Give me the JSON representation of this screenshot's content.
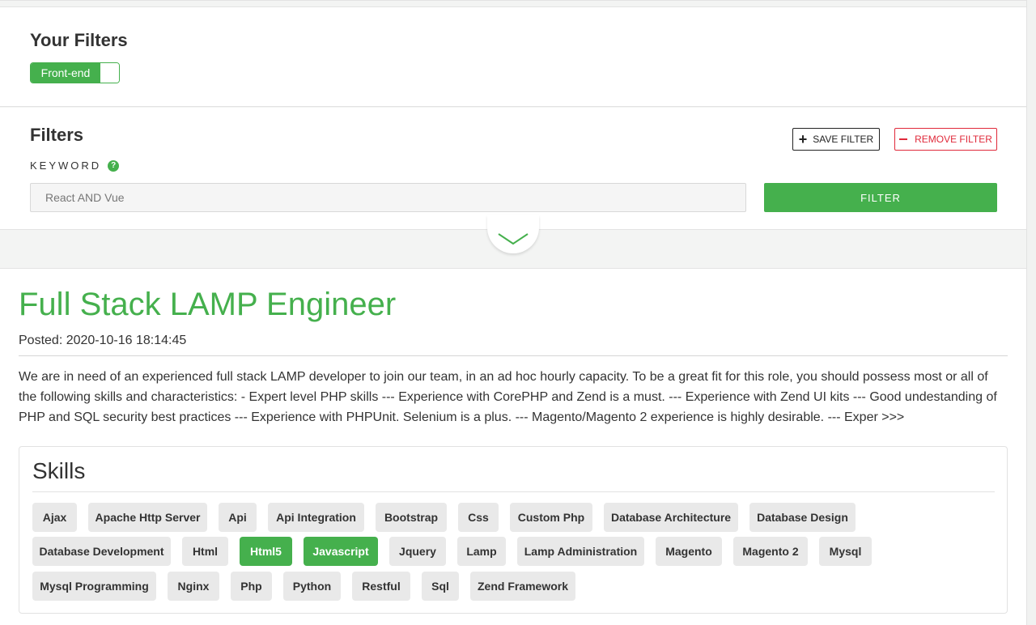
{
  "your_filters": {
    "title": "Your Filters",
    "chip_label": "Front-end"
  },
  "filters": {
    "title": "Filters",
    "save_label": "SAVE FILTER",
    "remove_label": "REMOVE FILTER",
    "keyword_label": "KEYWORD",
    "keyword_placeholder": "React AND Vue",
    "filter_button": "FILTER",
    "help_glyph": "?"
  },
  "job": {
    "title": "Full Stack LAMP Engineer",
    "posted": "Posted: 2020-10-16 18:14:45",
    "description": "We are in need of an experienced full stack LAMP developer to join our team, in an ad hoc hourly capacity. To be a great fit for this role, you should possess most or all of the following skills and characteristics: - Expert level PHP skills --- Experience with CorePHP and Zend is a must. --- Experience with Zend UI kits --- Good undestanding of PHP and SQL security best practices --- Experience with PHPUnit. Selenium is a plus. --- Magento/Magento 2 experience is highly desirable. --- Exper >>>"
  },
  "skills": {
    "title": "Skills",
    "items": [
      {
        "label": "Ajax",
        "active": false
      },
      {
        "label": "Apache Http Server",
        "active": false
      },
      {
        "label": "Api",
        "active": false
      },
      {
        "label": "Api Integration",
        "active": false
      },
      {
        "label": "Bootstrap",
        "active": false
      },
      {
        "label": "Css",
        "active": false
      },
      {
        "label": "Custom Php",
        "active": false
      },
      {
        "label": "Database Architecture",
        "active": false
      },
      {
        "label": "Database Design",
        "active": false
      },
      {
        "label": "Database Development",
        "active": false
      },
      {
        "label": "Html",
        "active": false
      },
      {
        "label": "Html5",
        "active": true
      },
      {
        "label": "Javascript",
        "active": true
      },
      {
        "label": "Jquery",
        "active": false
      },
      {
        "label": "Lamp",
        "active": false
      },
      {
        "label": "Lamp Administration",
        "active": false
      },
      {
        "label": "Magento",
        "active": false
      },
      {
        "label": "Magento 2",
        "active": false
      },
      {
        "label": "Mysql",
        "active": false
      },
      {
        "label": "Mysql Programming",
        "active": false
      },
      {
        "label": "Nginx",
        "active": false
      },
      {
        "label": "Php",
        "active": false
      },
      {
        "label": "Python",
        "active": false
      },
      {
        "label": "Restful",
        "active": false
      },
      {
        "label": "Sql",
        "active": false
      },
      {
        "label": "Zend Framework",
        "active": false
      }
    ]
  },
  "colors": {
    "accent": "#45b04d",
    "danger": "#e0293a",
    "chip_bg": "#e9e9e9"
  },
  "icons": {
    "save": "plus-icon",
    "remove": "minus-icon",
    "help": "question-circle-icon",
    "collapse": "chevron-down-icon"
  }
}
